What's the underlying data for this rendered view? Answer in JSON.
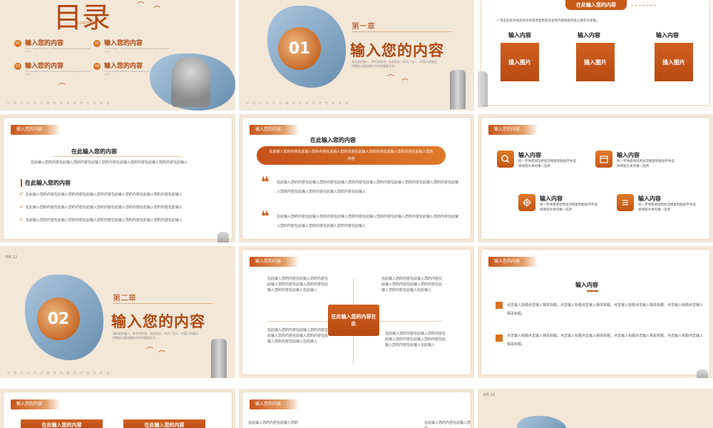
{
  "slides": {
    "s1": {
      "title": "目录",
      "subtitle": "CONTENTS",
      "items": [
        {
          "num": "01",
          "label": "输入您的内容",
          "desc": "The message content is always waiting for an opportunity to come."
        },
        {
          "num": "02",
          "label": "输入您的内容",
          "desc": "The message content is always waiting for an opportunity to come."
        },
        {
          "num": "03",
          "label": "输入您的内容",
          "desc": "The message content is always waiting for an opportunity to come."
        },
        {
          "num": "04",
          "label": "输入您的内容",
          "desc": "The message content is always waiting for an opportunity to come."
        }
      ],
      "footer": "中 国 红 色 文 化 教 育 党 政 宣 传 会 议 讲 座"
    },
    "s2": {
      "num": "01",
      "chapter": "第一章",
      "title": "输入您的内容",
      "desc": "请在此处输入，举手间传递，长此而去，四大广告人，中国人的展出传播会议展览输出中间的重要文字。",
      "footer": "中 国 红 色 文 化 教 育 党 政 宣 传 会 议 讲 座"
    },
    "s3": {
      "header": "在此输入您的内容",
      "bullet": "单击此处添加您的文本或者复制您适合的内容粘贴到此以填充文本框。",
      "cols": [
        {
          "label": "输入内容",
          "btn": "插入图片"
        },
        {
          "label": "输入内容",
          "btn": "插入图片"
        },
        {
          "label": "输入内容",
          "btn": "插入图片"
        }
      ]
    },
    "s4": {
      "tab": "输入您的内容",
      "title": "在此输入您的内容",
      "line": "在此输入您的内容在此输入您的内容在此输入您的内容在此输入您的内容在此输入您的内容在此输入",
      "sub": "在此输入您的内容",
      "items": [
        "在此输入您的内容在此输入您的内容在此输入您的内容在此输入您的内容在此输入您的内容在此输入",
        "在此输入您的内容在此输入您的内容在此输入您的内容在此输入您的内容在此输入您的内容在此输入",
        "在此输入您的内容在此输入您的内容在此输入您的内容在此输入您的内容在此输入您的内容在此输入"
      ]
    },
    "s5": {
      "tab": "输入您的内容",
      "title": "在此输入您的内容",
      "pill": "在此输入您的内容在此输入您的内容在此输入您的内容在此输入您的内容在此输入您的内容在此输入您的内容",
      "p1": "在此输入您的内容在此输入您的内容在此输入您的内容在此输入您的内容在此输入您的内容在此输入您的内容在此输入您的内容在此输入您的内容在此输入您的内容在此输入",
      "p2": "在此输入您的内容在此输入您的内容在此输入您的内容在此输入您的内容在此输入您的内容在此输入您的内容在此输入您的内容在此输入您的内容在此输入您的内容在此输入"
    },
    "s6": {
      "tab": "输入您的内容",
      "items": [
        {
          "title": "输入内容",
          "desc": "统一字体使阅读更加流畅复制粘贴字体选择保留文本的唯一选项"
        },
        {
          "title": "输入内容",
          "desc": "统一字体使阅读更加流畅复制粘贴字体选择保留文本的唯一选项"
        },
        {
          "title": "输入内容",
          "desc": "统一字体使阅读更加流畅复制粘贴字体选择保留文本的唯一选项"
        },
        {
          "title": "输入内容",
          "desc": "统一字体使阅读更加流畅复制粘贴字体选择保留文本的唯一选项"
        }
      ]
    },
    "s7": {
      "date": "8月 22",
      "num": "02",
      "chapter": "第二章",
      "title": "输入您的内容",
      "desc": "请在此处输入，举手间传递，长此而去，四大广告人，中国人的展出传播会议展览输出中间的重要文字。",
      "footer": "中 国 红 色 文 化 教 育 党 政 宣 传 会 议 讲 座"
    },
    "s8": {
      "tab": "输入您的内容",
      "center": "在此输入您的内容在此",
      "tl": "在此输入您的内容在此输入您的内容在此输入您的内容在此输入您的内容在此输入您的内容在此输入在此输入",
      "tr": "在此输入您的内容在此输入您的内容在此输入您的内容在此输入您的内容在此输入您的内容在此输入在此输入",
      "bl": "在此输入您的内容在此输入您的内容在此输入您的内容在此输入您的内容在此输入您的内容在此输入在此输入",
      "br": "在此输入您的内容在此输入您的内容在此输入您的内容在此输入您的内容在此输入您的内容在此输入在此输入"
    },
    "s9": {
      "tab": "输入您的内容",
      "title": "输入内容",
      "p1": "点击输入标题点击输入相关标题。点击输入标题点击输入相关标题。点击输入标题点击输入相关标题。点击输入标题点击输入相关标题。",
      "p2": "点击输入标题点击输入相关标题。点击输入标题点击输入相关标题。点击输入标题点击输入相关标题。点击输入标题点击输入相关标题。"
    },
    "s10": {
      "tab": "输入您的内容",
      "btn1": "在此输入您的内容",
      "btn2": "在此输入您的内容"
    },
    "s11": {
      "tab": "输入您的内容",
      "text1": "在此输入您的内容在此输入您的",
      "text2": "在此输入您的内容在此输入您的"
    },
    "s12": {
      "date": "8月 22"
    }
  },
  "colors": {
    "accent": "#c25515",
    "paper": "#f3e7d8",
    "title": "#b04a14"
  }
}
